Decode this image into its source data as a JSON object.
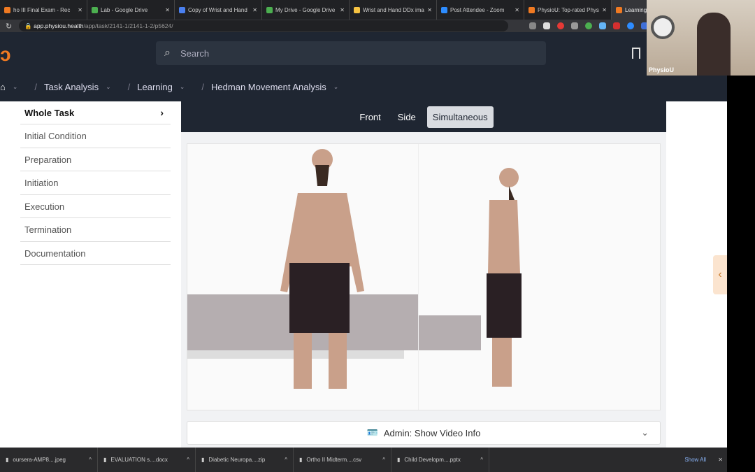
{
  "browser": {
    "tabs": [
      {
        "title": "ho III Final Exam - Rec",
        "color": "#f07a22"
      },
      {
        "title": "Lab - Google Drive",
        "color": "#4caf50"
      },
      {
        "title": "Copy of Wrist and Hand",
        "color": "#4a80f0"
      },
      {
        "title": "My Drive - Google Drive",
        "color": "#4caf50"
      },
      {
        "title": "Wrist and Hand DDx imag",
        "color": "#f6c342"
      },
      {
        "title": "Post Attendee - Zoom",
        "color": "#2d8cff"
      },
      {
        "title": "PhysioU: Top-rated Phys",
        "color": "#f07a22"
      },
      {
        "title": "Learning Hedman",
        "color": "#f07a22"
      }
    ],
    "url_host": "app.physiou.health",
    "url_path": "/app/task/2141-1/2141-1-2/p5624/"
  },
  "header": {
    "search_placeholder": "Search"
  },
  "breadcrumb": [
    "Task Analysis",
    "Learning",
    "Hedman Movement Analysis"
  ],
  "sidebar": {
    "items": [
      "Whole Task",
      "Initial Condition",
      "Preparation",
      "Initiation",
      "Execution",
      "Termination",
      "Documentation"
    ]
  },
  "views": {
    "tabs": [
      "Front",
      "Side",
      "Simultaneous"
    ],
    "active": "Simultaneous"
  },
  "admin": {
    "label": "Admin: Show Video Info"
  },
  "webcam": {
    "name": "PhysioU"
  },
  "downloads": {
    "items": [
      "oursera-AMP8....jpeg",
      "EVALUATION s....docx",
      "Diabetic Neuropa....zip",
      "Ortho II Midterm....csv",
      "Child Developm....pptx"
    ],
    "show_all": "Show All"
  }
}
